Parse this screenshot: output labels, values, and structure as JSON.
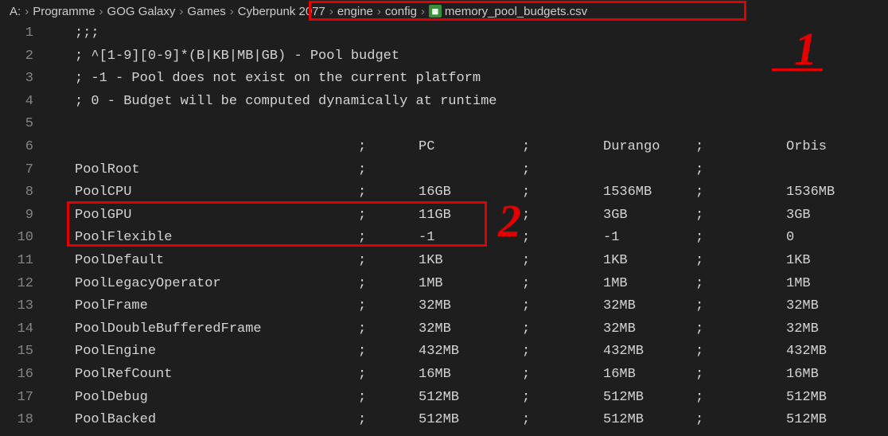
{
  "breadcrumb": {
    "drive": "A:",
    "items": [
      "Programme",
      "GOG Galaxy",
      "Games",
      "Cyberpunk 2077",
      "engine",
      "config"
    ],
    "file": "memory_pool_budgets.csv"
  },
  "annotations": {
    "one": "1",
    "two": "2"
  },
  "lines": [
    {
      "ln": 1,
      "text": ";;;"
    },
    {
      "ln": 2,
      "text": "; ^[1-9][0-9]*(B|KB|MB|GB) - Pool budget"
    },
    {
      "ln": 3,
      "text": "; -1 - Pool does not exist on the current platform"
    },
    {
      "ln": 4,
      "text": "; 0 - Budget will be computed dynamically at runtime"
    },
    {
      "ln": 5,
      "text": ""
    },
    {
      "ln": 6,
      "name": "",
      "pc": "PC",
      "durango": "Durango",
      "orbis": "Orbis",
      "semi": true
    },
    {
      "ln": 7,
      "name": "PoolRoot",
      "pc": "",
      "durango": "",
      "orbis": "",
      "semi": true
    },
    {
      "ln": 8,
      "name": "PoolCPU",
      "pc": "16GB",
      "durango": "1536MB",
      "orbis": "1536MB",
      "semi": true
    },
    {
      "ln": 9,
      "name": "PoolGPU",
      "pc": "11GB",
      "durango": "3GB",
      "orbis": "3GB",
      "semi": true
    },
    {
      "ln": 10,
      "name": "PoolFlexible",
      "pc": "-1",
      "durango": "-1",
      "orbis": "0",
      "semi": true
    },
    {
      "ln": 11,
      "name": "PoolDefault",
      "pc": "1KB",
      "durango": "1KB",
      "orbis": "1KB",
      "semi": true
    },
    {
      "ln": 12,
      "name": "PoolLegacyOperator",
      "pc": "1MB",
      "durango": "1MB",
      "orbis": "1MB",
      "semi": true
    },
    {
      "ln": 13,
      "name": "PoolFrame",
      "pc": "32MB",
      "durango": "32MB",
      "orbis": "32MB",
      "semi": true
    },
    {
      "ln": 14,
      "name": "PoolDoubleBufferedFrame",
      "pc": "32MB",
      "durango": "32MB",
      "orbis": "32MB",
      "semi": true
    },
    {
      "ln": 15,
      "name": "PoolEngine",
      "pc": "432MB",
      "durango": "432MB",
      "orbis": "432MB",
      "semi": true
    },
    {
      "ln": 16,
      "name": "PoolRefCount",
      "pc": "16MB",
      "durango": "16MB",
      "orbis": "16MB",
      "semi": true
    },
    {
      "ln": 17,
      "name": "PoolDebug",
      "pc": "512MB",
      "durango": "512MB",
      "orbis": "512MB",
      "semi": true
    },
    {
      "ln": 18,
      "name": "PoolBacked",
      "pc": "512MB",
      "durango": "512MB",
      "orbis": "512MB",
      "semi": true
    }
  ]
}
